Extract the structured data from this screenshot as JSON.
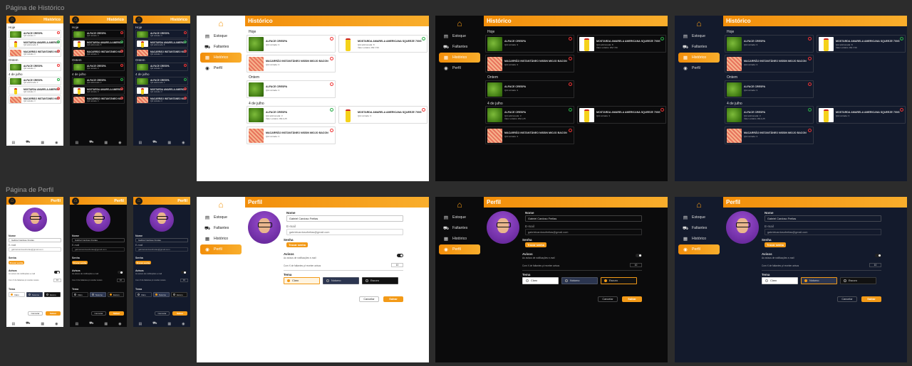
{
  "sections": {
    "history_title": "Página de Histórico",
    "profile_title": "Página de Perfil"
  },
  "app": {
    "brand_icon": "home-icon",
    "accent_color": "#f39a17",
    "nav": [
      {
        "label": "Estoque",
        "icon": "box-icon"
      },
      {
        "label": "Faltantes",
        "icon": "cart-icon"
      },
      {
        "label": "Histórico",
        "icon": "history-icon"
      },
      {
        "label": "Perfil",
        "icon": "profile-icon"
      }
    ]
  },
  "history": {
    "title": "Histórico",
    "groups": [
      "Hoje",
      "Ontem",
      "4 de julho"
    ],
    "items": {
      "lettuce": {
        "name": "ALFACE CRESPA",
        "qty": "Qtd retirada: 3"
      },
      "mustard": {
        "name": "MOSTARDA AMARELA AMERICANA SQUEEZE 700G",
        "qty": "Qtd adicionada: 8",
        "value": "Valor unitário: R$ 7,59"
      },
      "noodle": {
        "name": "MACARRÃO INSTANTÂNEO NISSIN MIOJO BACON",
        "qty": "Qtd retirada: 3"
      },
      "mustard2": {
        "name": "MOSTARDA AMARELA AMERICANA SQUEEZE 700G",
        "qty": "Qtd retirada: 3"
      },
      "lettuce2": {
        "name": "ALFACE CRESPA",
        "qty": "Qtd adicionada: 3",
        "value": "Valor unitário: R$ 4,25"
      }
    }
  },
  "profile": {
    "title": "Perfil",
    "name_label": "Nome",
    "name_value": "Gabriel Cardoso Freitas",
    "email_label": "E-mail",
    "email_value": "gabrielcardosofreitas@gmail.com",
    "password_label": "Senha",
    "change_password": "Trocar senha",
    "notices_label": "Avisos",
    "notices_desc": "Ao avisos de notificações e-mail",
    "notify_desc": "Com X de faltantes p/ receber avisos",
    "notify_value": "10",
    "theme_label": "Tema",
    "themes": [
      "Claro",
      "Noturno",
      "Escuro"
    ],
    "cancel": "Cancelar",
    "save": "Salvar"
  }
}
